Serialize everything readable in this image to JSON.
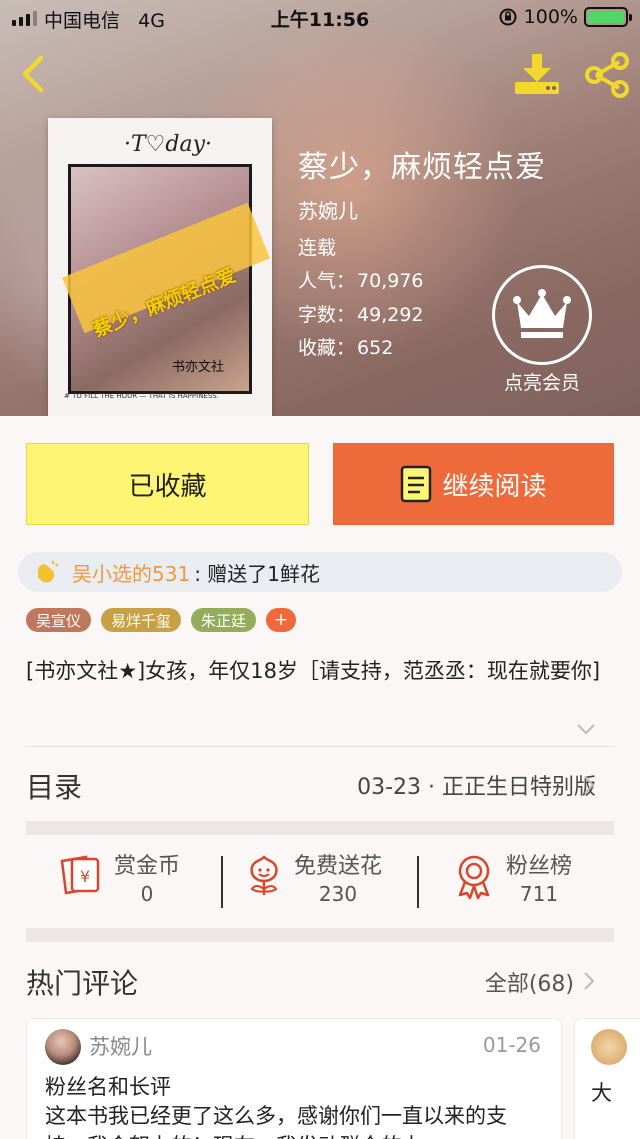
{
  "status_bar": {
    "carrier": "中国电信",
    "network": "4G",
    "time": "上午11:56",
    "battery": "100%",
    "battery_level": 1.0
  },
  "book": {
    "title": "蔡少，麻烦轻点爱",
    "author": "苏婉儿",
    "status": "连载",
    "popularity_label": "人气：",
    "popularity": "70,976",
    "words_label": "字数：",
    "words": "49,292",
    "favorites_label": "收藏：",
    "favorites": "652"
  },
  "cover": {
    "today_text": "·T♡day·",
    "title_text": "蔡少，麻烦轻点爱",
    "publisher_seal": "书亦文社",
    "bottom_text": "# TO FILL THE HOUR — THAT IS HAPPINESS."
  },
  "vip": {
    "label": "点亮会员"
  },
  "actions": {
    "collected_label": "已收藏",
    "read_label": "继续阅读"
  },
  "gift": {
    "user": "吴小选的531",
    "message": ": 赠送了1鲜花"
  },
  "tags": [
    {
      "label": "吴宣仪",
      "color": "#c0785c"
    },
    {
      "label": "易烊千玺",
      "color": "#c9a145"
    },
    {
      "label": "朱正廷",
      "color": "#93ad5c"
    },
    {
      "label": "+",
      "color": "#ee6a3b"
    }
  ],
  "intro": "[书亦文社★]女孩，年仅18岁［请支持，范丞丞：现在就要你]",
  "toc": {
    "label": "目录",
    "latest": "03-23 · 正正生日特别版"
  },
  "stats": {
    "reward_label": "赏金币",
    "reward_value": "0",
    "flower_label": "免费送花",
    "flower_value": "230",
    "fans_label": "粉丝榜",
    "fans_value": "711"
  },
  "comments": {
    "label": "热门评论",
    "all_label": "全部(68)",
    "items": [
      {
        "author": "苏婉儿",
        "date": "01-26",
        "title": "粉丝名和长评",
        "body": "这本书我已经更了这么多，感谢你们一直以来的支持，我会努力的！现在，我发动群众的力"
      },
      {
        "text": "大"
      }
    ]
  },
  "colors": {
    "accent_orange": "#ee6a3b",
    "collected_yellow": "#fef575",
    "gift_user": "#ee9a3b"
  }
}
